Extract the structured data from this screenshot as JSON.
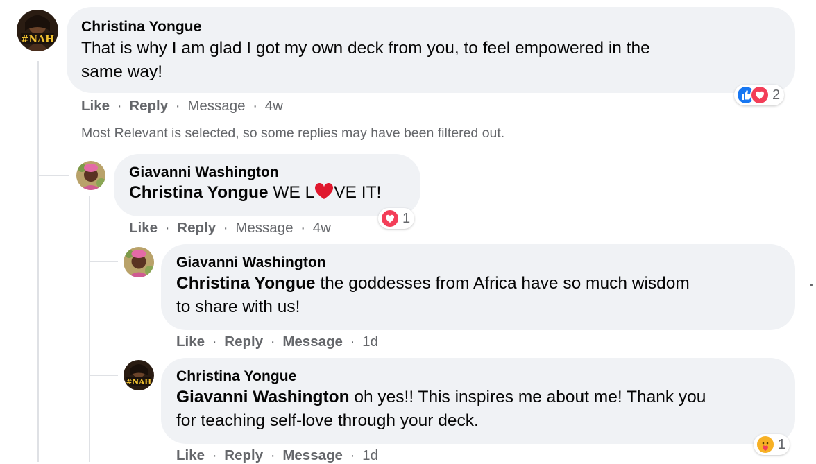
{
  "comment": {
    "author": "Christina Yongue",
    "text_line1": "That is why I am glad I got my own deck from you, to feel empowered in the",
    "text_line2": "same way!",
    "actions": {
      "like": "Like",
      "reply": "Reply",
      "message": "Message",
      "time": "4w",
      "sep": "·"
    },
    "reactions": {
      "count": "2",
      "icons": [
        "like-icon",
        "love-icon"
      ]
    },
    "avatar_text": "#NAH"
  },
  "filter_note": "Most Relevant is selected, so some replies may have been filtered out.",
  "replies": [
    {
      "author": "Giavanni Washington",
      "mention": "Christina Yongue",
      "text_a": " WE L",
      "text_b": "VE IT!",
      "actions": {
        "like": "Like",
        "reply": "Reply",
        "message": "Message",
        "time": "4w",
        "sep": "·"
      },
      "reactions": {
        "count": "1",
        "icons": [
          "love-icon"
        ]
      }
    },
    {
      "author": "Giavanni Washington",
      "mention": "Christina Yongue",
      "text_line1": " the goddesses from Africa have so much wisdom",
      "text_line2": "to share with us!",
      "actions": {
        "like": "Like",
        "reply": "Reply",
        "message": "Message",
        "time": "1d",
        "sep": "·"
      }
    },
    {
      "author": "Christina Yongue",
      "mention": "Giavanni Washington",
      "text_line1": " oh yes!! This inspires me about me! Thank you",
      "text_line2": "for teaching self-love through your deck.",
      "actions": {
        "like": "Like",
        "reply": "Reply",
        "message": "Message",
        "time": "1d",
        "sep": "·"
      },
      "reactions": {
        "count": "1",
        "icons": [
          "care-icon"
        ]
      },
      "avatar_text": "#NAH"
    }
  ],
  "colors": {
    "bubble": "#f0f2f5",
    "meta": "#65676b",
    "like_blue": "#1877f2",
    "love_red": "#f33e58",
    "care_yellow": "#f7b125"
  }
}
